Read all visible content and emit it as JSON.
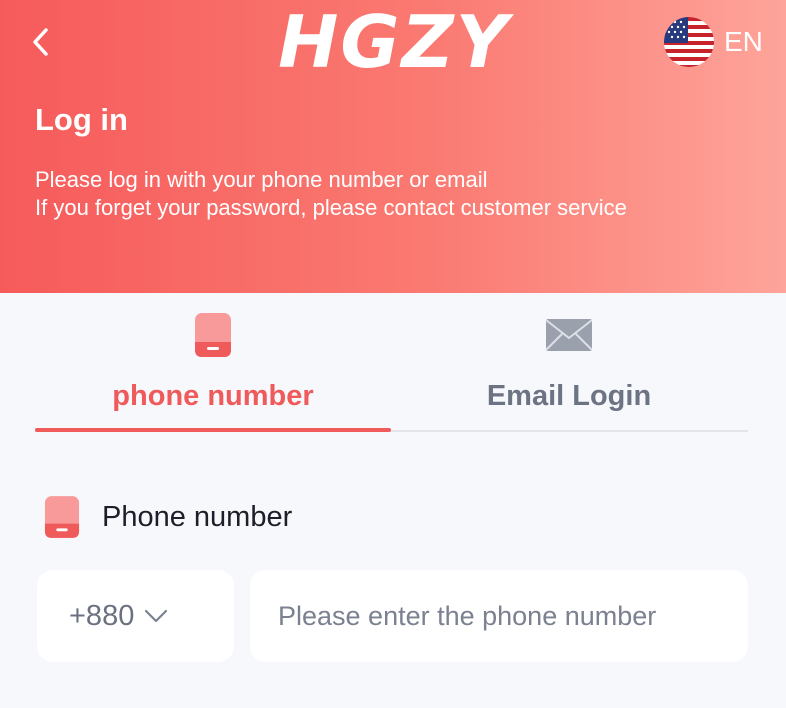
{
  "header": {
    "logo": "HGZY",
    "language": "EN",
    "title": "Log in",
    "description_line1": "Please log in with your phone number or email",
    "description_line2": "If you forget your password, please contact customer service"
  },
  "tabs": [
    {
      "label": "phone number",
      "icon": "phone-icon",
      "active": true
    },
    {
      "label": "Email Login",
      "icon": "mail-icon",
      "active": false
    }
  ],
  "form": {
    "phone_label": "Phone number",
    "country_code": "+880",
    "phone_placeholder": "Please enter the phone number",
    "phone_value": ""
  },
  "colors": {
    "accent": "#ef5a5a",
    "header_gradient_start": "#f65b5b",
    "header_gradient_end": "#fea49a",
    "inactive_tab": "#6c7382",
    "background": "#f7f8fc"
  }
}
